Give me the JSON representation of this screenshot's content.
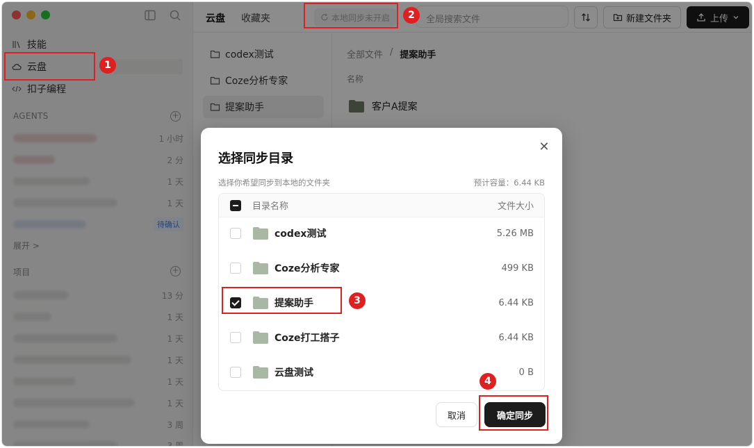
{
  "sidebar": {
    "nav": [
      {
        "label": "技能",
        "icon": "books-icon"
      },
      {
        "label": "云盘",
        "icon": "cloud-icon"
      },
      {
        "label": "扣子编程",
        "icon": "code-icon"
      }
    ],
    "agents_title": "AGENTS",
    "agent_times": [
      "1 小时",
      "2 分",
      "1 天",
      "1 天",
      "待确认"
    ],
    "expand_label": "展开 >",
    "projects_title": "项目",
    "project_times": [
      "13 分",
      "1 天",
      "1 天",
      "1 天",
      "1 天",
      "1 天",
      "3 周",
      "3 周"
    ]
  },
  "topbar": {
    "tabs": [
      "云盘",
      "收藏夹"
    ],
    "sync_status": "本地同步未开启",
    "search_placeholder": "全局搜索文件",
    "new_folder_label": "新建文件夹",
    "upload_label": "上传"
  },
  "folders": [
    "codex测试",
    "Coze分析专家",
    "提案助手"
  ],
  "content": {
    "breadcrumb": [
      "全部文件",
      "提案助手"
    ],
    "column_name": "名称",
    "files": [
      "客户A提案"
    ]
  },
  "modal": {
    "title": "选择同步目录",
    "subtitle": "选择你希望同步到本地的文件夹",
    "capacity": "预计容量：6.44 KB",
    "header_name": "目录名称",
    "header_size": "文件大小",
    "rows": [
      {
        "name": "codex测试",
        "size": "5.26 MB",
        "checked": false
      },
      {
        "name": "Coze分析专家",
        "size": "499 KB",
        "checked": false
      },
      {
        "name": "提案助手",
        "size": "6.44 KB",
        "checked": true
      },
      {
        "name": "Coze打工搭子",
        "size": "6.44 KB",
        "checked": false
      },
      {
        "name": "云盘测试",
        "size": "0 B",
        "checked": false
      }
    ],
    "cancel_label": "取消",
    "confirm_label": "确定同步"
  },
  "annotations": [
    "1",
    "2",
    "3",
    "4"
  ],
  "colors": {
    "accent_red": "#e02020",
    "dark_button": "#1c1c1c",
    "folder": "#a9b8a5"
  }
}
